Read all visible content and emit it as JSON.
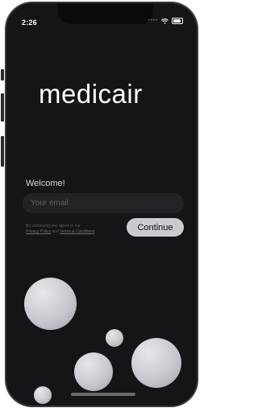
{
  "status_bar": {
    "time": "2:26",
    "signal_dots": "••••"
  },
  "brand": {
    "logo_text": "medicair"
  },
  "login": {
    "welcome_text": "Welcome!",
    "email_placeholder": "Your email",
    "legal_prefix": "By continuing you agree to our",
    "privacy_link": "Privacy Policy",
    "legal_and": "and",
    "terms_link": "Terms & Conditions",
    "continue_label": "Continue"
  },
  "colors": {
    "background": "#141517",
    "button": "#c9cbd0",
    "input_bg": "#222326",
    "text_primary": "#ffffff"
  }
}
